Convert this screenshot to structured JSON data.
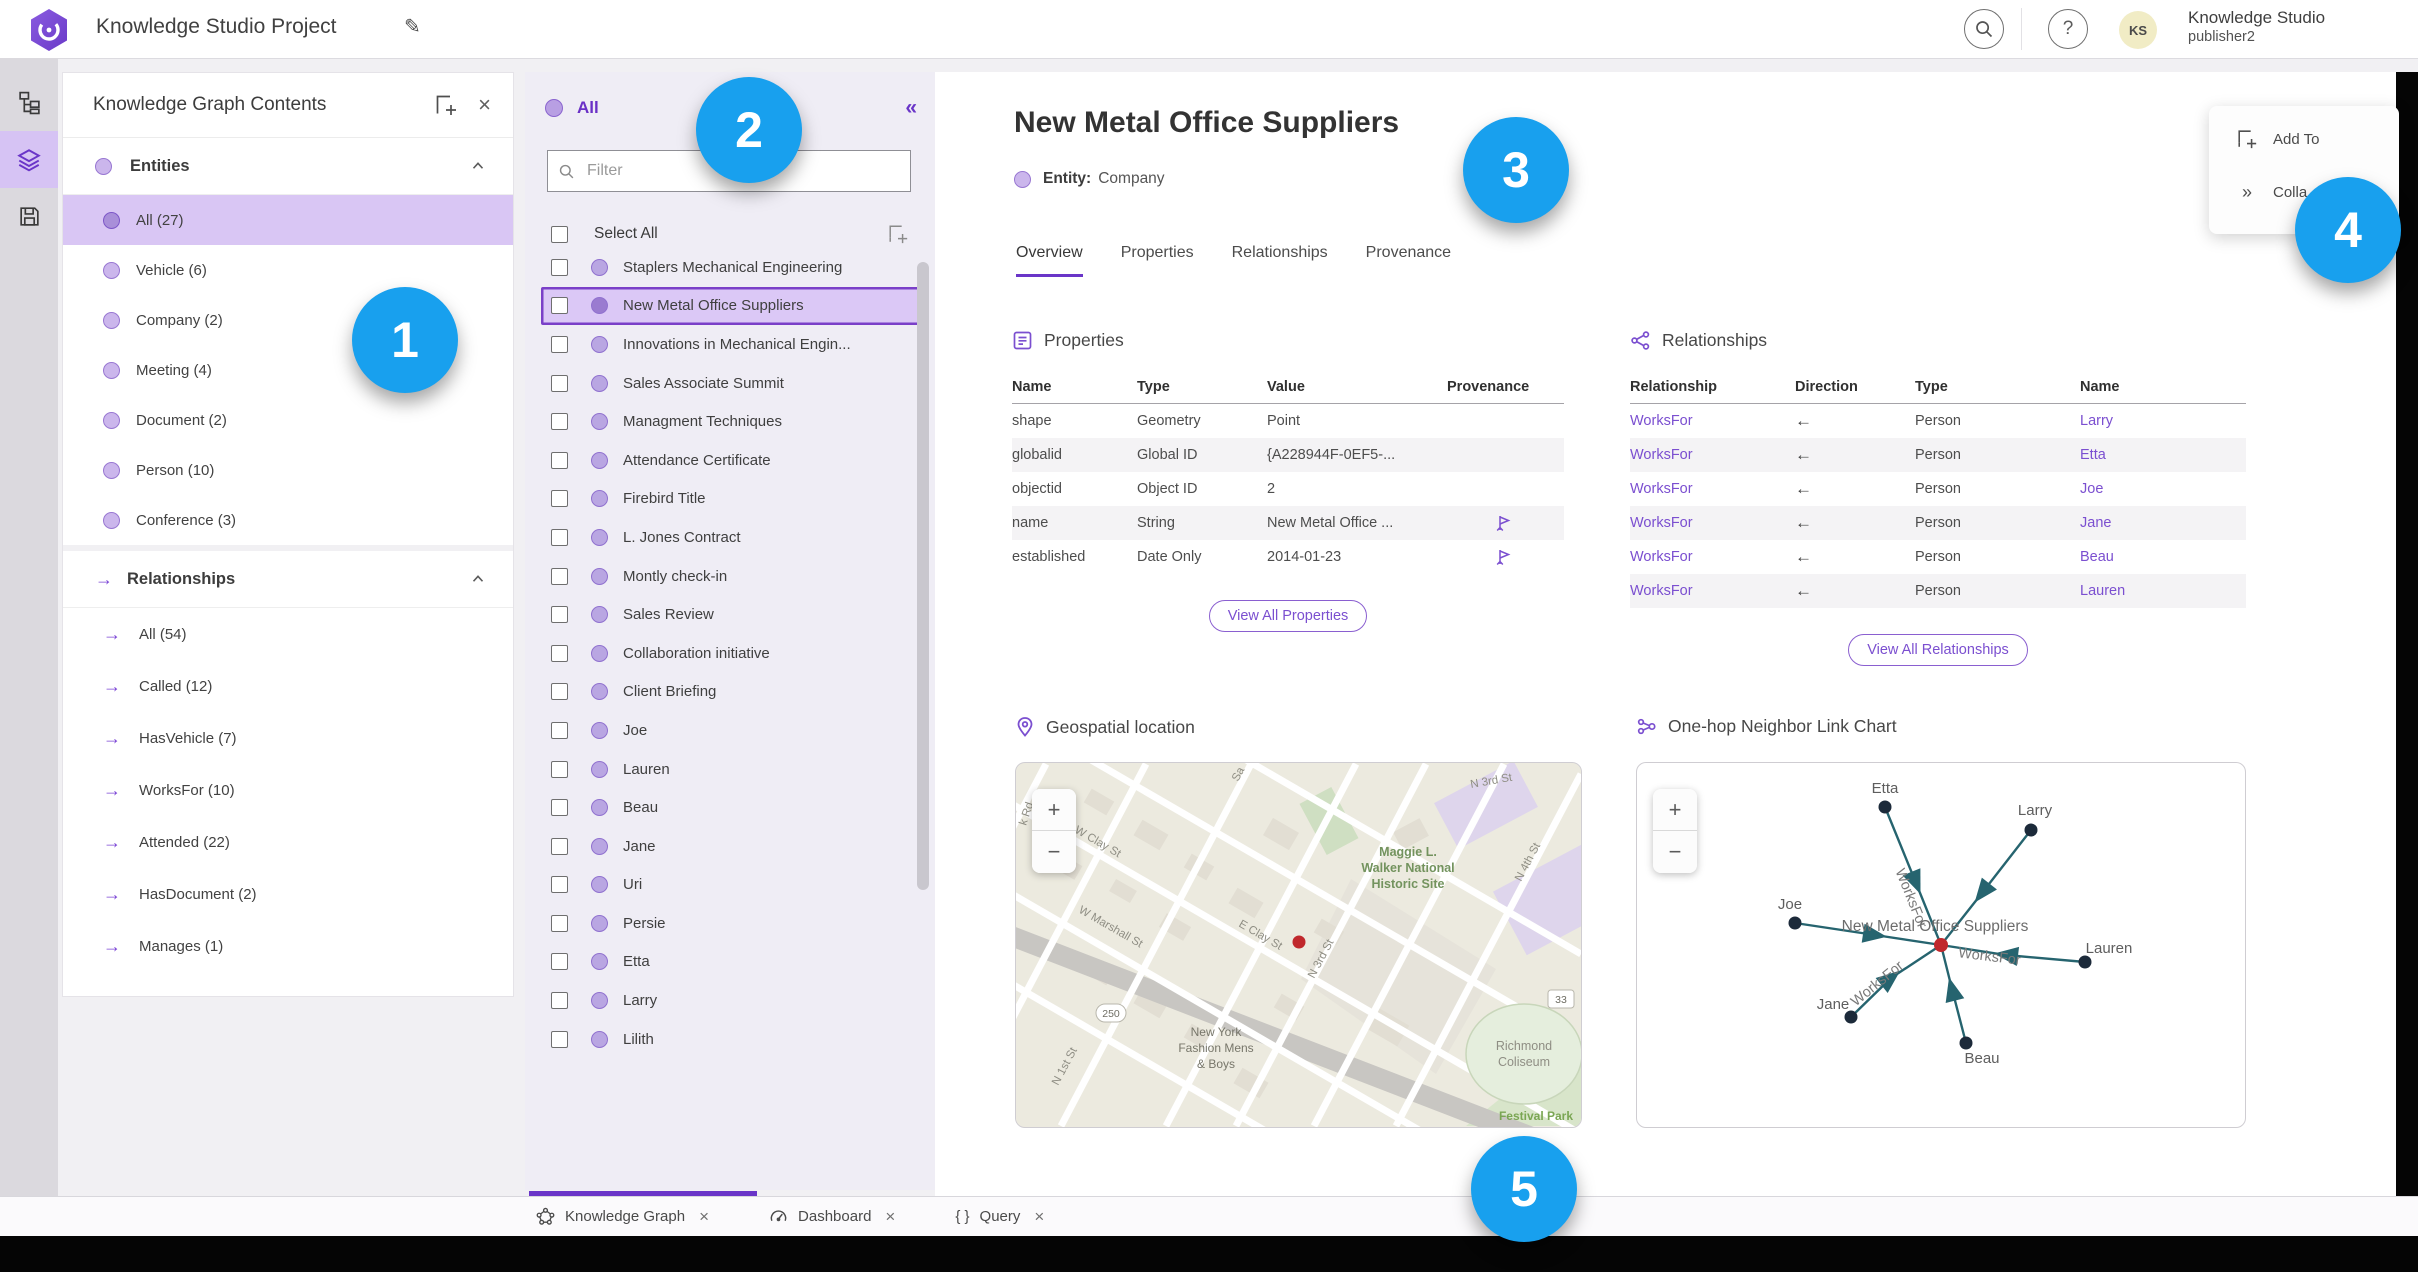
{
  "app": {
    "title": "Knowledge Studio Project"
  },
  "topbar": {
    "account_name": "Knowledge Studio",
    "account_user": "publisher2",
    "avatar_initials": "KS",
    "help_glyph": "?"
  },
  "contents_panel": {
    "title": "Knowledge Graph Contents",
    "entities_header": "Entities",
    "entities": [
      {
        "label": "All (27)"
      },
      {
        "label": "Vehicle (6)"
      },
      {
        "label": "Company (2)"
      },
      {
        "label": "Meeting (4)"
      },
      {
        "label": "Document (2)"
      },
      {
        "label": "Person (10)"
      },
      {
        "label": "Conference (3)"
      }
    ],
    "relationships_header": "Relationships",
    "relationships": [
      {
        "label": "All (54)"
      },
      {
        "label": "Called (12)"
      },
      {
        "label": "HasVehicle (7)"
      },
      {
        "label": "WorksFor (10)"
      },
      {
        "label": "Attended (22)"
      },
      {
        "label": "HasDocument (2)"
      },
      {
        "label": "Manages (1)"
      }
    ]
  },
  "list_panel": {
    "header": "All",
    "filter_placeholder": "Filter",
    "select_all_label": "Select All",
    "collapse_glyph": "«",
    "items": [
      {
        "label": "Staplers Mechanical Engineering"
      },
      {
        "label": "New Metal Office Suppliers"
      },
      {
        "label": "Innovations in Mechanical Engin..."
      },
      {
        "label": "Sales Associate Summit"
      },
      {
        "label": "Managment Techniques"
      },
      {
        "label": "Attendance Certificate"
      },
      {
        "label": "Firebird Title"
      },
      {
        "label": "L. Jones Contract"
      },
      {
        "label": "Montly check-in"
      },
      {
        "label": "Sales Review"
      },
      {
        "label": "Collaboration initiative"
      },
      {
        "label": "Client Briefing"
      },
      {
        "label": "Joe"
      },
      {
        "label": "Lauren"
      },
      {
        "label": "Beau"
      },
      {
        "label": "Jane"
      },
      {
        "label": "Uri"
      },
      {
        "label": "Persie"
      },
      {
        "label": "Etta"
      },
      {
        "label": "Larry"
      },
      {
        "label": "Lilith"
      }
    ]
  },
  "detail": {
    "title": "New Metal Office Suppliers",
    "entity_label": "Entity:",
    "entity_type": "Company",
    "tabs": [
      {
        "label": "Overview"
      },
      {
        "label": "Properties"
      },
      {
        "label": "Relationships"
      },
      {
        "label": "Provenance"
      }
    ],
    "properties": {
      "section_title": "Properties",
      "columns": {
        "name": "Name",
        "type": "Type",
        "value": "Value",
        "provenance": "Provenance"
      },
      "rows": [
        {
          "name": "shape",
          "type": "Geometry",
          "value": "Point",
          "provenance": false
        },
        {
          "name": "globalid",
          "type": "Global ID",
          "value": "{A228944F-0EF5-...",
          "provenance": false
        },
        {
          "name": "objectid",
          "type": "Object ID",
          "value": "2",
          "provenance": false
        },
        {
          "name": "name",
          "type": "String",
          "value": "New Metal Office ...",
          "provenance": true
        },
        {
          "name": "established",
          "type": "Date Only",
          "value": "2014-01-23",
          "provenance": true
        }
      ],
      "view_all_label": "View All Properties"
    },
    "relationships": {
      "section_title": "Relationships",
      "columns": {
        "relationship": "Relationship",
        "direction": "Direction",
        "type": "Type",
        "name": "Name"
      },
      "rows": [
        {
          "relationship": "WorksFor",
          "direction": "←",
          "type": "Person",
          "name": "Larry"
        },
        {
          "relationship": "WorksFor",
          "direction": "←",
          "type": "Person",
          "name": "Etta"
        },
        {
          "relationship": "WorksFor",
          "direction": "←",
          "type": "Person",
          "name": "Joe"
        },
        {
          "relationship": "WorksFor",
          "direction": "←",
          "type": "Person",
          "name": "Jane"
        },
        {
          "relationship": "WorksFor",
          "direction": "←",
          "type": "Person",
          "name": "Beau"
        },
        {
          "relationship": "WorksFor",
          "direction": "←",
          "type": "Person",
          "name": "Lauren"
        }
      ],
      "view_all_label": "View All Relationships"
    },
    "map": {
      "section_title": "Geospatial location",
      "zoom_in": "+",
      "zoom_out": "−",
      "labels": {
        "k_rd": "k Rd",
        "sa": "Sa",
        "w_clay": "W Clay St",
        "n3rd_top": "N 3rd St",
        "n4th": "N 4th St",
        "maggie_1": "Maggie L.",
        "maggie_2": "Walker National",
        "maggie_3": "Historic Site",
        "marshall": "W Marshall St",
        "e_clay": "E Clay St",
        "n3rd_mid": "N 3rd St",
        "n1st": "N 1st St",
        "nyf_1": "New York",
        "nyf_2": "Fashion Mens",
        "nyf_3": "& Boys",
        "richmond_1": "Richmond",
        "richmond_2": "Coliseum",
        "festival": "Festival Park",
        "shield_250": "250",
        "shield_33": "33"
      }
    },
    "link_chart": {
      "section_title": "One-hop Neighbor Link Chart",
      "zoom_in": "+",
      "zoom_out": "−",
      "center_label": "New Metal Office Suppliers",
      "edge_label": "WorksFor",
      "nodes": [
        {
          "label": "Etta"
        },
        {
          "label": "Larry"
        },
        {
          "label": "Joe"
        },
        {
          "label": "Lauren"
        },
        {
          "label": "Jane"
        },
        {
          "label": "Beau"
        }
      ]
    }
  },
  "overlay_menu": {
    "add_to": "Add To",
    "collapse": "Colla"
  },
  "bottom_tabs": [
    {
      "label": "Knowledge Graph"
    },
    {
      "label": "Dashboard"
    },
    {
      "label": "Query"
    }
  ],
  "query_tab_glyph": "{ }",
  "callouts": [
    {
      "n": "1"
    },
    {
      "n": "2"
    },
    {
      "n": "3"
    },
    {
      "n": "4"
    },
    {
      "n": "5"
    }
  ],
  "colors": {
    "accent": "#6a35c8",
    "callout_blue": "#18a0ee",
    "edge_teal": "#26646f",
    "node_red": "#c0282c",
    "link_purple": "#7b4fd0"
  }
}
